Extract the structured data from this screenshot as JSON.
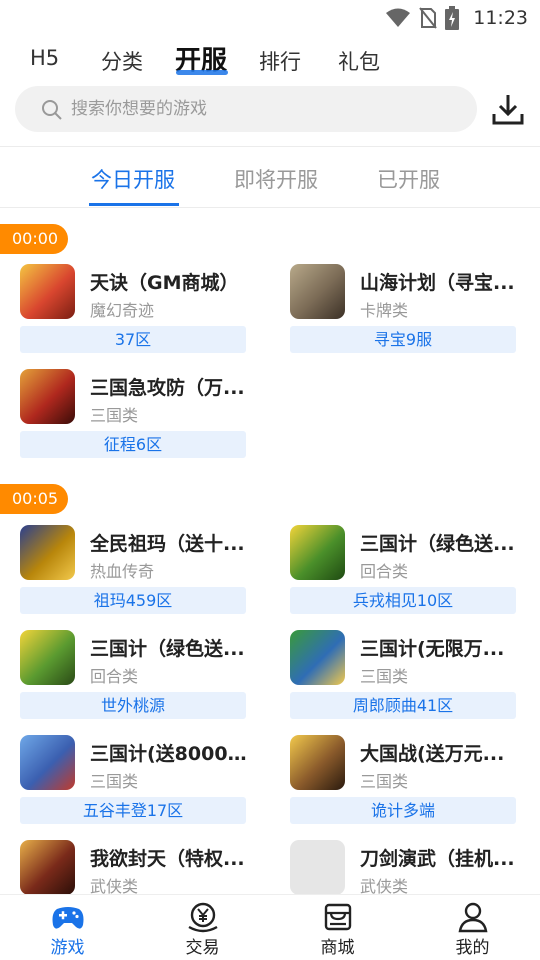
{
  "status_bar": {
    "time": "11:23",
    "icons": [
      "wifi-icon",
      "no-sim-icon",
      "battery-charging-icon"
    ]
  },
  "top_tabs": [
    {
      "label": "H5",
      "active": false
    },
    {
      "label": "分类",
      "active": false
    },
    {
      "label": "开服",
      "active": true
    },
    {
      "label": "排行",
      "active": false
    },
    {
      "label": "礼包",
      "active": false
    }
  ],
  "search": {
    "placeholder": "搜索你想要的游戏",
    "icon": "search-icon"
  },
  "header_action": {
    "icon": "download-icon"
  },
  "sub_tabs": [
    {
      "label": "今日开服",
      "active": true
    },
    {
      "label": "即将开服",
      "active": false
    },
    {
      "label": "已开服",
      "active": false
    }
  ],
  "groups": [
    {
      "time": "00:00",
      "games": [
        {
          "name": "天诀（GM商城）",
          "category": "魔幻奇迹",
          "server": "37区",
          "color": "#d9462f"
        },
        {
          "name": "山海计划（寻宝...",
          "category": "卡牌类",
          "server": "寻宝9服",
          "color": "#7a6a55"
        },
        {
          "name": "三国急攻防（万...",
          "category": "三国类",
          "server": "征程6区",
          "color": "#b0281e"
        }
      ]
    },
    {
      "time": "00:05",
      "games": [
        {
          "name": "全民祖玛（送十...",
          "category": "热血传奇",
          "server": "祖玛459区",
          "color": "#b8860b"
        },
        {
          "name": "三国计（绿色送...",
          "category": "回合类",
          "server": "兵戎相见10区",
          "color": "#4a8f2a"
        },
        {
          "name": "三国计（绿色送...",
          "category": "回合类",
          "server": "世外桃源",
          "color": "#5a9a30"
        },
        {
          "name": "三国计(无限万...",
          "category": "三国类",
          "server": "周郎顾曲41区",
          "color": "#2f6db5"
        },
        {
          "name": "三国计(送8000...",
          "category": "三国类",
          "server": "五谷丰登17区",
          "color": "#3b5fb0"
        },
        {
          "name": "大国战(送万元...",
          "category": "三国类",
          "server": "诡计多端",
          "color": "#8a5a2b"
        },
        {
          "name": "我欲封天（特权...",
          "category": "武侠类",
          "server": "",
          "color": "#7a2a1a"
        },
        {
          "name": "刀剑演武（挂机...",
          "category": "武侠类",
          "server": "",
          "color": "#e6e6e6"
        }
      ]
    }
  ],
  "bottom_nav": [
    {
      "label": "游戏",
      "icon": "gamepad-icon",
      "active": true
    },
    {
      "label": "交易",
      "icon": "yuan-coin-icon",
      "active": false
    },
    {
      "label": "商城",
      "icon": "store-icon",
      "active": false
    },
    {
      "label": "我的",
      "icon": "user-icon",
      "active": false
    }
  ],
  "colors": {
    "accent": "#1a73e8",
    "time_badge": "#ff8a00",
    "server_bg": "#e8f1fd"
  }
}
